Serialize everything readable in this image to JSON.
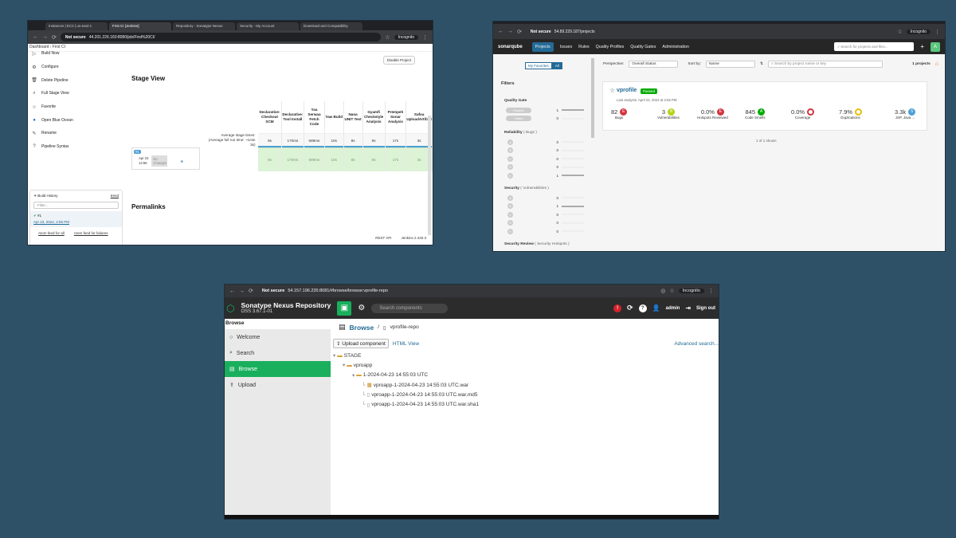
{
  "jenkins": {
    "tabs": [
      "Instances | EC2 | us-east-1",
      "First CI [Jenkins]",
      "Repository - Sonatype Nexus",
      "Security - My Account",
      "Download and Compatibility"
    ],
    "url": "44.201.226.160:8080/job/First%20CI/",
    "not_secure": "Not secure",
    "incognito": "Incognito",
    "breadcrumb": [
      "Dashboard",
      "First CI"
    ],
    "sidebar": [
      "Build Now",
      "Configure",
      "Delete Pipeline",
      "Full Stage View",
      "Favorite",
      "Open Blue Ocean",
      "Rename",
      "Pipeline Syntax"
    ],
    "sidebar_icons": [
      "play-icon",
      "gear-icon",
      "trash-icon",
      "search-icon",
      "star-icon",
      "ocean-icon",
      "pencil-icon",
      "help-icon"
    ],
    "build_history": {
      "title": "Build History",
      "trend": "trend",
      "filter_placeholder": "Filter...",
      "build": "#1",
      "date": "Apr 23, 2024, 2:55 PM",
      "feed_all": "Atom feed for all",
      "feed_failures": "Atom feed for failures"
    },
    "stage_view_title": "Stage View",
    "disable_button": "Disable Project",
    "avg_label": "Average stage times:",
    "avg_full": "(Average full run time: ~1min 3s)",
    "run": {
      "num": "#1",
      "date": "Apr 23",
      "time": "14:55",
      "changes": "No Changes"
    },
    "stages": [
      {
        "name": "Declarative: Checkout SCM",
        "avg": "9s",
        "val": "9s"
      },
      {
        "name": "Declarative: Tool Install",
        "avg": "170ms",
        "val": "170ms"
      },
      {
        "name": "Yaa Serwaa Fetch Code",
        "avg": "689ms",
        "val": "689ms"
      },
      {
        "name": "Yaw Build",
        "avg": "10s",
        "val": "10s"
      },
      {
        "name": "Nana UNIT Test",
        "avg": "8s",
        "val": "8s"
      },
      {
        "name": "Gyamfi Checkstyle Analysis",
        "avg": "9s",
        "val": "9s"
      },
      {
        "name": "Prempeh Sonar Analysis",
        "avg": "17s",
        "val": "17s"
      },
      {
        "name": "Safoa UploadArtifact",
        "avg": "3s",
        "val": "3s"
      }
    ],
    "permalinks": "Permalinks",
    "footer": {
      "rest": "REST API",
      "version": "Jenkins 2.440.3"
    }
  },
  "sonar": {
    "url": "54.89.229.187/projects",
    "not_secure": "Not secure",
    "incognito": "Incognito",
    "logo": "sonarqube",
    "nav": [
      "Projects",
      "Issues",
      "Rules",
      "Quality Profiles",
      "Quality Gates",
      "Administration"
    ],
    "search_placeholder": "Search for projects and files...",
    "avatar": "A",
    "fav": [
      "My Favorites",
      "All"
    ],
    "filters_title": "Filters",
    "quality_gate": {
      "title": "Quality Gate",
      "rows": [
        {
          "label": "Passed",
          "count": "1"
        },
        {
          "label": "Failed",
          "count": "0"
        }
      ]
    },
    "reliability": {
      "title": "Reliability",
      "sub": "( Bugs )",
      "rows": [
        {
          "label": "A",
          "count": "0"
        },
        {
          "label": "B",
          "count": "0"
        },
        {
          "label": "C",
          "count": "0"
        },
        {
          "label": "D",
          "count": "0"
        },
        {
          "label": "E",
          "count": "1"
        }
      ]
    },
    "security": {
      "title": "Security",
      "sub": "( Vulnerabilities )",
      "rows": [
        {
          "label": "A",
          "count": "0"
        },
        {
          "label": "B",
          "count": "1"
        },
        {
          "label": "C",
          "count": "0"
        },
        {
          "label": "D",
          "count": "0"
        },
        {
          "label": "E",
          "count": "0"
        }
      ]
    },
    "security_review": {
      "title": "Security Review",
      "sub": "( Security Hotspots )"
    },
    "perspective_label": "Perspective:",
    "perspective": "Overall Status",
    "sortby_label": "Sort by:",
    "sortby": "Name",
    "search_projects": "Search by project name or key",
    "projects_count": "1 projects",
    "project": {
      "name": "vprofile",
      "status": "Passed",
      "last_analysis": "Last analysis: April 23, 2024 at 2:55 PM",
      "metrics": [
        {
          "value": "82",
          "rating": "E",
          "label": "Bugs",
          "color": "#d4333f"
        },
        {
          "value": "3",
          "rating": "B",
          "label": "Vulnerabilities",
          "color": "#b0d513"
        },
        {
          "value": "0.0%",
          "rating": "E",
          "label": "Hotspots Reviewed",
          "color": "#d4333f"
        },
        {
          "value": "845",
          "rating": "A",
          "label": "Code Smells",
          "color": "#00aa00"
        },
        {
          "value": "0.0%",
          "rating": "",
          "label": "Coverage",
          "color": "#d4333f"
        },
        {
          "value": "7.9%",
          "rating": "",
          "label": "Duplications",
          "color": "#eabe06"
        },
        {
          "value": "3.3k",
          "rating": "S",
          "label": "JSP, Java ...",
          "color": "#4b9fd5"
        }
      ]
    },
    "shown": "1 of 1 shown"
  },
  "nexus": {
    "url": "54.157.196.235:8081/#browse/browse:vprofile-repo",
    "not_secure": "Not secure",
    "incognito": "Incognito",
    "brand": "Sonatype Nexus Repository",
    "version": "OSS 3.67.1-01",
    "search_placeholder": "Search components",
    "user": "admin",
    "signout": "Sign out",
    "browse_header": "Browse",
    "sidebar": [
      "Welcome",
      "Search",
      "Browse",
      "Upload"
    ],
    "breadcrumb_browse": "Browse",
    "breadcrumb_repo": "vprofile-repo",
    "upload_button": "Upload component",
    "html_view": "HTML View",
    "advanced": "Advanced search...",
    "tree": [
      {
        "label": "STAGE",
        "level": 0,
        "kind": "folder"
      },
      {
        "label": "vproapp",
        "level": 1,
        "kind": "folder"
      },
      {
        "label": "1-2024-04-23 14:55:03 UTC",
        "level": 2,
        "kind": "folder"
      },
      {
        "label": "vproapp-1-2024-04-23 14:55:03 UTC.war",
        "level": 3,
        "kind": "war"
      },
      {
        "label": "vproapp-1-2024-04-23 14:55:03 UTC.war.md5",
        "level": 3,
        "kind": "file"
      },
      {
        "label": "vproapp-1-2024-04-23 14:55:03 UTC.war.sha1",
        "level": 3,
        "kind": "file"
      }
    ]
  }
}
